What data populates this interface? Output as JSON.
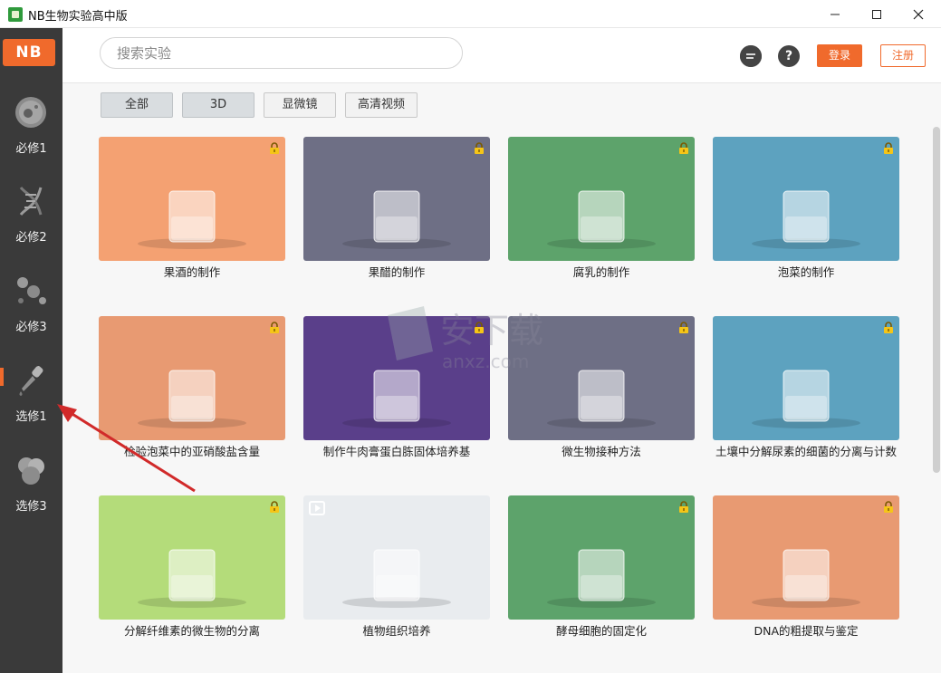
{
  "window": {
    "title": "NB生物实验高中版",
    "min": "—",
    "max": "☐",
    "close": "✕"
  },
  "sidebar": {
    "logo": "NB",
    "items": [
      {
        "label": "必修1",
        "icon": "cell-icon"
      },
      {
        "label": "必修2",
        "icon": "dna-icon"
      },
      {
        "label": "必修3",
        "icon": "molecule-icon"
      },
      {
        "label": "选修1",
        "icon": "dropper-icon",
        "active": true
      },
      {
        "label": "选修3",
        "icon": "cells-cluster-icon"
      }
    ]
  },
  "header": {
    "search_placeholder": "搜索实验",
    "login_label": "登录",
    "register_label": "注册",
    "chat_icon": "chat-icon",
    "help_icon": "help-icon",
    "help_glyph": "?"
  },
  "tabs": [
    {
      "label": "全部",
      "active": true
    },
    {
      "label": "3D",
      "active": true
    },
    {
      "label": "显微镜",
      "active": false
    },
    {
      "label": "高清视频",
      "active": false
    }
  ],
  "experiments": [
    {
      "title": "果酒的制作",
      "bg": "#f4a172",
      "locked": true
    },
    {
      "title": "果醋的制作",
      "bg": "#6e6f85",
      "locked": true
    },
    {
      "title": "腐乳的制作",
      "bg": "#5da36b",
      "locked": true
    },
    {
      "title": "泡菜的制作",
      "bg": "#5da2bf",
      "locked": true
    },
    {
      "title": "检验泡菜中的亚硝酸盐含量",
      "bg": "#e89a72",
      "locked": true
    },
    {
      "title": "制作牛肉膏蛋白胨固体培养基",
      "bg": "#5a3f8a",
      "locked": true
    },
    {
      "title": "微生物接种方法",
      "bg": "#6e6f85",
      "locked": true
    },
    {
      "title": "土壤中分解尿素的细菌的分离与计数",
      "bg": "#5da2bf",
      "locked": true
    },
    {
      "title": "分解纤维素的微生物的分离",
      "bg": "#b4dc7a",
      "locked": true
    },
    {
      "title": "植物组织培养",
      "bg": "#e9ecef",
      "locked": false,
      "video": true
    },
    {
      "title": "酵母细胞的固定化",
      "bg": "#5da36b",
      "locked": true
    },
    {
      "title": "DNA的粗提取与鉴定",
      "bg": "#e89a72",
      "locked": true
    }
  ],
  "watermark": {
    "text": "安下载",
    "sub": "anxz.com"
  },
  "colors": {
    "accent": "#f06a2c",
    "sidebar": "#3a3a3a"
  }
}
